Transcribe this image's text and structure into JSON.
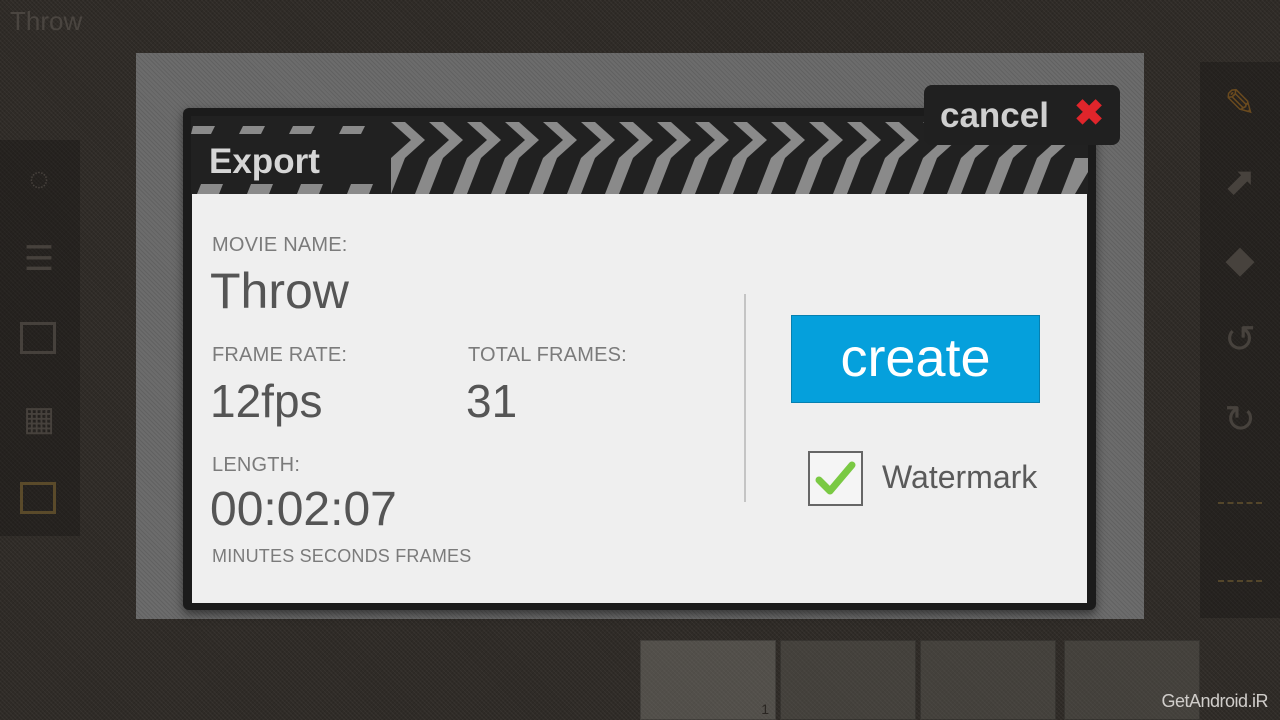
{
  "app": {
    "title": "Throw"
  },
  "dialog": {
    "title": "Export",
    "cancel_label": "cancel",
    "movie_name_label": "MOVIE NAME:",
    "movie_name": "Throw",
    "frame_rate_label": "FRAME RATE:",
    "frame_rate": "12fps",
    "total_frames_label": "TOTAL FRAMES:",
    "total_frames": "31",
    "length_label": "LENGTH:",
    "length": "00:02:07",
    "length_units": "MINUTES SECONDS FRAMES",
    "create_label": "create",
    "watermark_label": "Watermark",
    "watermark_checked": true
  },
  "filmstrip": {
    "current_frame_number": "1"
  },
  "watermark_text": "GetAndroid.iR",
  "colors": {
    "create_button": "#05a0dc",
    "cancel_icon": "#e0252b",
    "check": "#7ac943"
  },
  "icons": {
    "cancel": "close-x-icon",
    "watermark": "checkmark-icon",
    "toolbar_right": [
      "pencil-icon",
      "fill-bucket-icon",
      "eraser-icon",
      "undo-icon",
      "redo-icon"
    ]
  }
}
